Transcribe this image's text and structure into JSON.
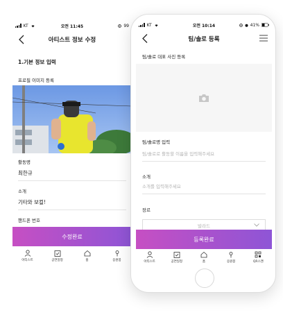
{
  "back_screen": {
    "status": {
      "carrier": "KT",
      "time": "오전 11:45",
      "battery": "99"
    },
    "nav_title": "아티스트 정보 수정",
    "section_title": "1.기본 정보 입력",
    "profile_image_label": "프로필 이미지 등록",
    "fields": [
      {
        "label": "활동명",
        "value": "최한규"
      },
      {
        "label": "소개",
        "value": "기타와 보컬!"
      }
    ],
    "phone_label": "핸드폰 번호",
    "submit_label": "수정완료"
  },
  "front_screen": {
    "status": {
      "carrier": "KT",
      "time": "오전 10:14",
      "battery": "41%"
    },
    "nav_title": "팀/솔로 등록",
    "photo_label": "팀/솔로 대표 사진 등록",
    "name_label": "팀/솔로명 입력",
    "name_placeholder": "팀/솔로로 활동할 이름을 입력해주세요",
    "intro_label": "소개",
    "intro_placeholder": "소개를 입력해주세요",
    "genre_label": "장르",
    "genre_selected": "발라드",
    "submit_label": "등록완료"
  },
  "tabbar": {
    "items": [
      {
        "label": "아티스트",
        "icon": "artist-icon"
      },
      {
        "label": "공연일정",
        "icon": "calendar-icon"
      },
      {
        "label": "홈",
        "icon": "home-icon"
      },
      {
        "label": "응원봉",
        "icon": "lightstick-icon"
      },
      {
        "label": "QR스캔",
        "icon": "qr-icon"
      }
    ]
  },
  "colors": {
    "gradient_start": "#c64fc3",
    "gradient_end": "#8e55d6"
  }
}
